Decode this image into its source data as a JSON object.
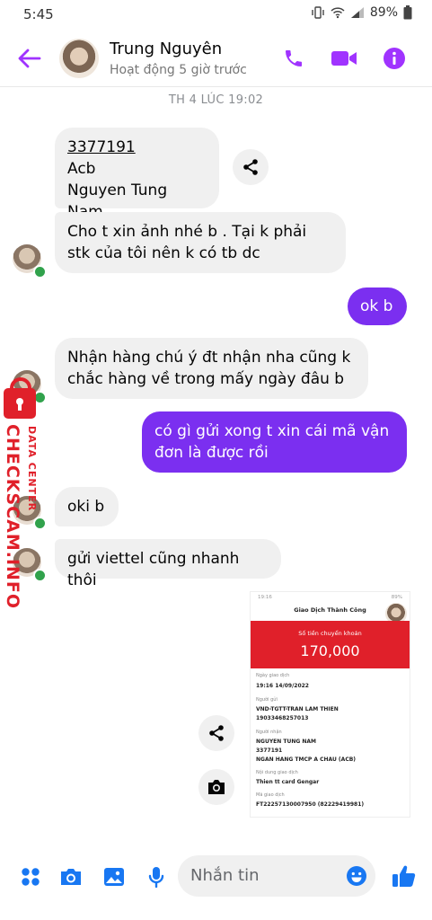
{
  "status_bar": {
    "time": "5:45",
    "battery": "89%"
  },
  "header": {
    "name": "Trung Nguyên",
    "status": "Hoạt động 5 giờ trước"
  },
  "timestamp": "TH 4 LÚC 19:02",
  "messages": [
    {
      "dir": "in",
      "lines": [
        "3377191",
        "Acb",
        "Nguyen Tung Nam"
      ]
    },
    {
      "dir": "in",
      "text": "Cho t xin ảnh nhé b . Tại k phải stk của tôi nên k có tb dc"
    },
    {
      "dir": "out",
      "text": "ok b"
    },
    {
      "dir": "in",
      "text": "Nhận hàng chú ý đt nhận nha cũng k chắc hàng về trong mấy ngày đâu b"
    },
    {
      "dir": "out",
      "text": "có gì gửi xong t xin cái mã vận đơn là được rồi"
    },
    {
      "dir": "in",
      "text": "oki b"
    },
    {
      "dir": "in",
      "text": "gửi viettel cũng nhanh thôi"
    }
  ],
  "watermark": {
    "line1": "DATA CENTER",
    "line2": "CHECKSCAM.INFO"
  },
  "receipt": {
    "status_time": "19:16",
    "status_right": "89%",
    "title": "Giao Dịch Thành Công",
    "amount_label": "Số tiền chuyển khoản",
    "amount": "170,000",
    "fields": [
      {
        "label": "Ngày giao dịch",
        "value": "19:16 14/09/2022"
      },
      {
        "label": "Người gửi",
        "value": "VND-TGTT-TRAN LAM THIEN",
        "value2": "19033468257013"
      },
      {
        "label": "Người nhận",
        "value": "NGUYEN TUNG NAM",
        "value2": "3377191",
        "value3": "NGAN HANG TMCP A CHAU (ACB)"
      },
      {
        "label": "Nội dung giao dịch",
        "value": "Thien tt card Gengar"
      },
      {
        "label": "Mã giao dịch",
        "value": "FT22257130007950 (82229419981)"
      }
    ]
  },
  "composer": {
    "placeholder": "Nhắn tin"
  },
  "colors": {
    "accent": "#a033ff",
    "outgoing": "#7b2ff0",
    "incoming": "#f0f0f0",
    "receipt_red": "#e0202a"
  }
}
